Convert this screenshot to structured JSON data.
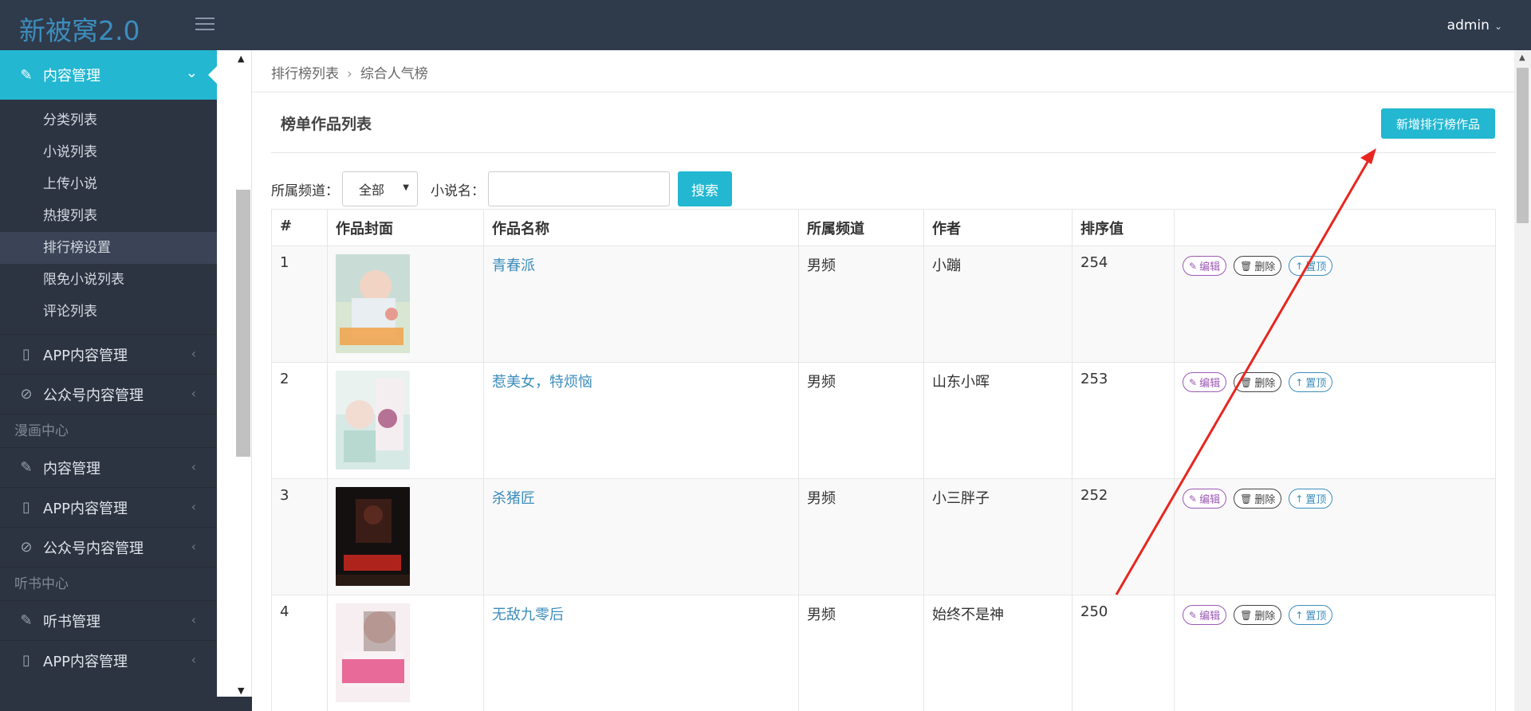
{
  "app": {
    "logo": "新被窝2.0",
    "user": "admin"
  },
  "sidebar": {
    "active_group": {
      "label": "内容管理",
      "icon": "brush-icon"
    },
    "sub_items": [
      {
        "label": "分类列表",
        "active": false
      },
      {
        "label": "小说列表",
        "active": false
      },
      {
        "label": "上传小说",
        "active": false
      },
      {
        "label": "热搜列表",
        "active": false
      },
      {
        "label": "排行榜设置",
        "active": true
      },
      {
        "label": "限免小说列表",
        "active": false
      },
      {
        "label": "评论列表",
        "active": false
      }
    ],
    "groups_a": [
      {
        "label": "APP内容管理",
        "icon": "phone-icon"
      },
      {
        "label": "公众号内容管理",
        "icon": "compass-icon"
      }
    ],
    "header_comics": "漫画中心",
    "groups_b": [
      {
        "label": "内容管理",
        "icon": "brush-icon"
      },
      {
        "label": "APP内容管理",
        "icon": "phone-icon"
      },
      {
        "label": "公众号内容管理",
        "icon": "compass-icon"
      }
    ],
    "header_audio": "听书中心",
    "groups_c": [
      {
        "label": "听书管理",
        "icon": "brush-icon"
      },
      {
        "label": "APP内容管理",
        "icon": "phone-icon"
      }
    ]
  },
  "breadcrumb": {
    "parent": "排行榜列表",
    "current": "综合人气榜"
  },
  "panel": {
    "title": "榜单作品列表",
    "add_button": "新增排行榜作品"
  },
  "filter": {
    "channel_label": "所属频道：",
    "channel_value": "全部",
    "name_label": "小说名：",
    "name_value": "",
    "search_button": "搜索"
  },
  "table": {
    "headers": [
      "#",
      "作品封面",
      "作品名称",
      "所属频道",
      "作者",
      "排序值",
      ""
    ],
    "rows": [
      {
        "num": "1",
        "title": "青春派",
        "channel": "男频",
        "author": "小蹦",
        "sort": "254"
      },
      {
        "num": "2",
        "title": "惹美女，特烦恼",
        "channel": "男频",
        "author": "山东小晖",
        "sort": "253"
      },
      {
        "num": "3",
        "title": "杀猪匠",
        "channel": "男频",
        "author": "小三胖子",
        "sort": "252"
      },
      {
        "num": "4",
        "title": "无敌九零后",
        "channel": "男频",
        "author": "始终不是神",
        "sort": "250"
      }
    ],
    "actions": {
      "edit": "编辑",
      "delete": "删除",
      "top": "置顶"
    }
  },
  "colors": {
    "accent": "#23b7d1",
    "topbar": "#2f3a4b",
    "sidebar": "#2d3441",
    "annotation": "#e8261f"
  }
}
